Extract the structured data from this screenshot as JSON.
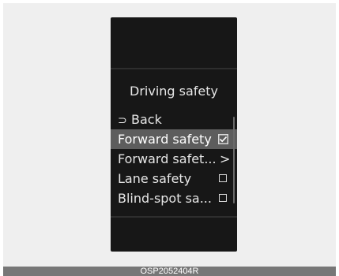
{
  "screen": {
    "title": "Driving safety",
    "back": {
      "icon": "return-arrow-icon",
      "icon_glyph": "⊃",
      "label": "Back"
    },
    "items": [
      {
        "label": "Forward safety",
        "control": "checkbox",
        "checked": true,
        "selected": true
      },
      {
        "label": "Forward safet...",
        "control": "chevron",
        "chevron_glyph": ">",
        "checked": false,
        "selected": false
      },
      {
        "label": "Lane safety",
        "control": "checkbox",
        "checked": false,
        "selected": false
      },
      {
        "label": "Blind-spot sa...",
        "control": "checkbox",
        "checked": false,
        "selected": false
      }
    ]
  },
  "caption": "OSP2052404R",
  "colors": {
    "frame_background": "#efefef",
    "screen_background": "#171717",
    "selection_highlight": "#5d5d5d",
    "caption_bar": "#777777",
    "text": "#e6e6e6"
  }
}
